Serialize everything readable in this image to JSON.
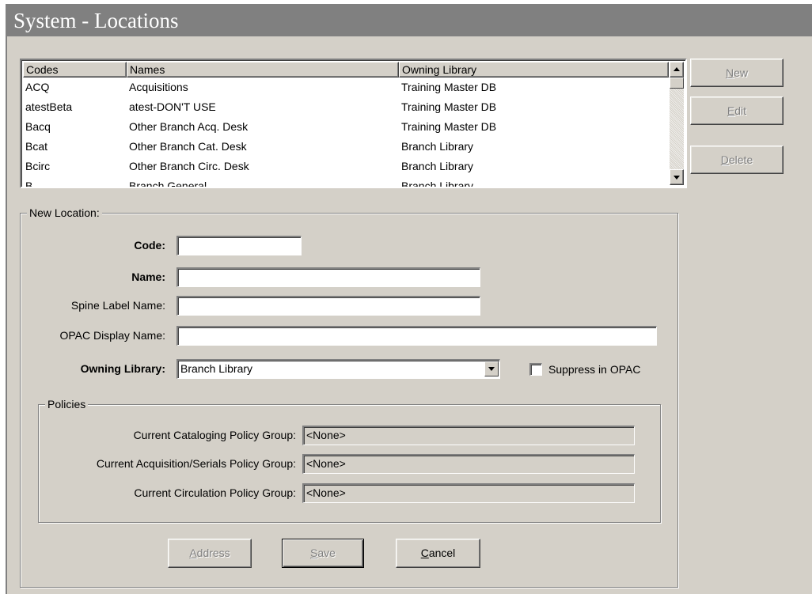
{
  "window": {
    "title": "System - Locations"
  },
  "list": {
    "columns": [
      "Codes",
      "Names",
      "Owning Library"
    ],
    "rows": [
      {
        "code": "ACQ",
        "name": "Acquisitions",
        "library": "Training Master DB"
      },
      {
        "code": "atestBeta",
        "name": "atest-DON'T USE",
        "library": "Training Master DB"
      },
      {
        "code": "Bacq",
        "name": "Other Branch Acq. Desk",
        "library": "Training Master DB"
      },
      {
        "code": "Bcat",
        "name": "Other Branch Cat. Desk",
        "library": "Branch Library"
      },
      {
        "code": "Bcirc",
        "name": "Other Branch Circ. Desk",
        "library": "Branch Library"
      },
      {
        "code": "B...",
        "name": "Branch General",
        "library": "Branch Library"
      }
    ]
  },
  "actions": {
    "new": {
      "label": "New",
      "accel": "N",
      "rest": "ew"
    },
    "edit": {
      "label": "Edit",
      "accel": "E",
      "rest": "dit"
    },
    "delete": {
      "label": "Delete",
      "accel": "D",
      "rest": "elete"
    }
  },
  "form": {
    "group_label": "New  Location:",
    "code_label": "Code:",
    "code_value": "",
    "name_label": "Name:",
    "name_value": "",
    "spine_label": "Spine Label Name:",
    "spine_value": "",
    "opac_label": "OPAC Display Name:",
    "opac_value": "",
    "owning_label": "Owning Library:",
    "owning_value": "Branch Library",
    "suppress_label": "Suppress in OPAC",
    "suppress_checked": false
  },
  "policies": {
    "group_label": "Policies",
    "cataloging_label": "Current Cataloging Policy Group:",
    "cataloging_value": "<None>",
    "acquisition_label": "Current Acquisition/Serials Policy Group:",
    "acquisition_value": "<None>",
    "circulation_label": "Current Circulation Policy Group:",
    "circulation_value": "<None>"
  },
  "footer": {
    "address": {
      "label": "Address",
      "accel": "A",
      "rest": "ddress"
    },
    "save": {
      "label": "Save",
      "accel": "S",
      "rest": "ave"
    },
    "cancel": {
      "label": "Cancel",
      "accel": "C",
      "rest": "ancel"
    }
  },
  "colors": {
    "face": "#d4d0c8",
    "shadow": "#808080",
    "titlebar": "#808080",
    "disabled_text": "#808080"
  }
}
